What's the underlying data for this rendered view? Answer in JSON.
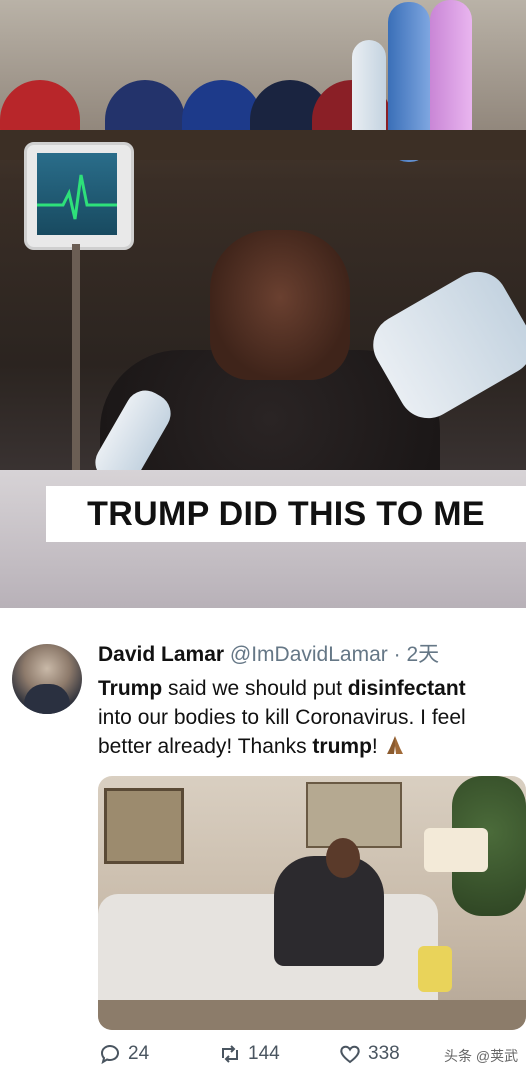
{
  "meme": {
    "caption": "TRUMP DID THIS TO ME"
  },
  "tweet": {
    "author_name": "David Lamar",
    "handle": "@ImDavidLamar",
    "separator": "·",
    "time": "2天",
    "line1_a": "Trump",
    "line1_b": " said we should put ",
    "line1_c": "disinfectant",
    "line2": "into our bodies to kill Coronavirus. I feel",
    "line3_a": "better already! Thanks ",
    "line3_b": "trump",
    "line3_c": "!",
    "emoji": "folded-hands"
  },
  "actions": {
    "replies": "24",
    "retweets": "144",
    "likes": "338"
  },
  "watermark": "头条 @荚武"
}
